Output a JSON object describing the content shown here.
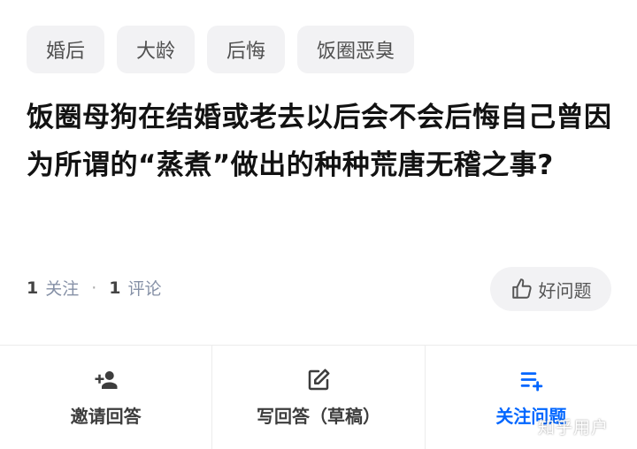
{
  "tags": [
    "婚后",
    "大龄",
    "后悔",
    "饭圈恶臭"
  ],
  "question": {
    "title": "饭圈母狗在结婚或老去以后会不会后悔自己曾因为所谓的“蒸煮”做出的种种荒唐无稽之事?"
  },
  "meta": {
    "follow_count": "1",
    "follow_label": "关注",
    "separator": "·",
    "comment_count": "1",
    "comment_label": "评论"
  },
  "good_question": {
    "label": "好问题",
    "icon": "thumbs-up-icon"
  },
  "actions": [
    {
      "label": "邀请回答",
      "icon": "invite-user-icon"
    },
    {
      "label": "写回答（草稿）",
      "icon": "edit-icon"
    },
    {
      "label": "关注问题",
      "icon": "follow-list-icon"
    }
  ],
  "watermark": "知乎用户",
  "colors": {
    "accent": "#0066ff",
    "tag_bg": "#f2f2f4",
    "meta_gray": "#8590a6"
  }
}
